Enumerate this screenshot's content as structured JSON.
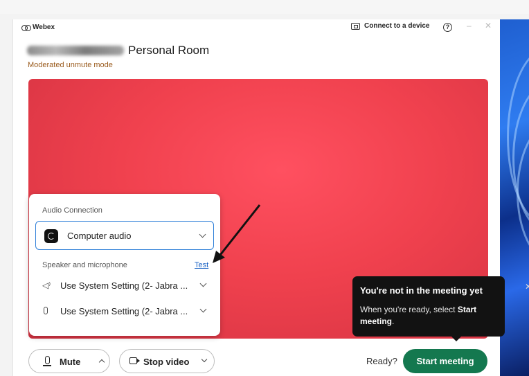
{
  "app": {
    "name": "Webex"
  },
  "titlebar": {
    "connect_label": "Connect to a device",
    "help_glyph": "?",
    "minimize_glyph": "–",
    "close_glyph": "✕"
  },
  "room": {
    "title": "Personal Room",
    "mode": "Moderated unmute mode"
  },
  "audio": {
    "heading": "Audio Connection",
    "selected": "Computer audio",
    "speaker_mic_label": "Speaker and microphone",
    "test_link": "Test",
    "speaker_value": "Use System Setting (2- Jabra ...",
    "microphone_value": "Use System Setting (2- Jabra ..."
  },
  "toast": {
    "title": "You're not in the meeting yet",
    "body_prefix": "When you're ready, select ",
    "body_bold": "Start meeting",
    "body_suffix": "."
  },
  "controls": {
    "mute_label": "Mute",
    "stop_video_label": "Stop video",
    "ready_label": "Ready?",
    "start_meeting_label": "Start meeting"
  },
  "colors": {
    "stage": "#f0414e",
    "start_button": "#14784f",
    "subtitle": "#9a5b1d",
    "link": "#1a62c4",
    "focus_border": "#2f7fd8",
    "toast_bg": "#121212"
  },
  "icons": [
    "webex-logo-icon",
    "device-icon",
    "help-icon",
    "audio-app-icon",
    "speaker-icon",
    "microphone-icon",
    "chevron-down-icon",
    "chevron-up-icon",
    "camera-icon",
    "close-icon"
  ]
}
